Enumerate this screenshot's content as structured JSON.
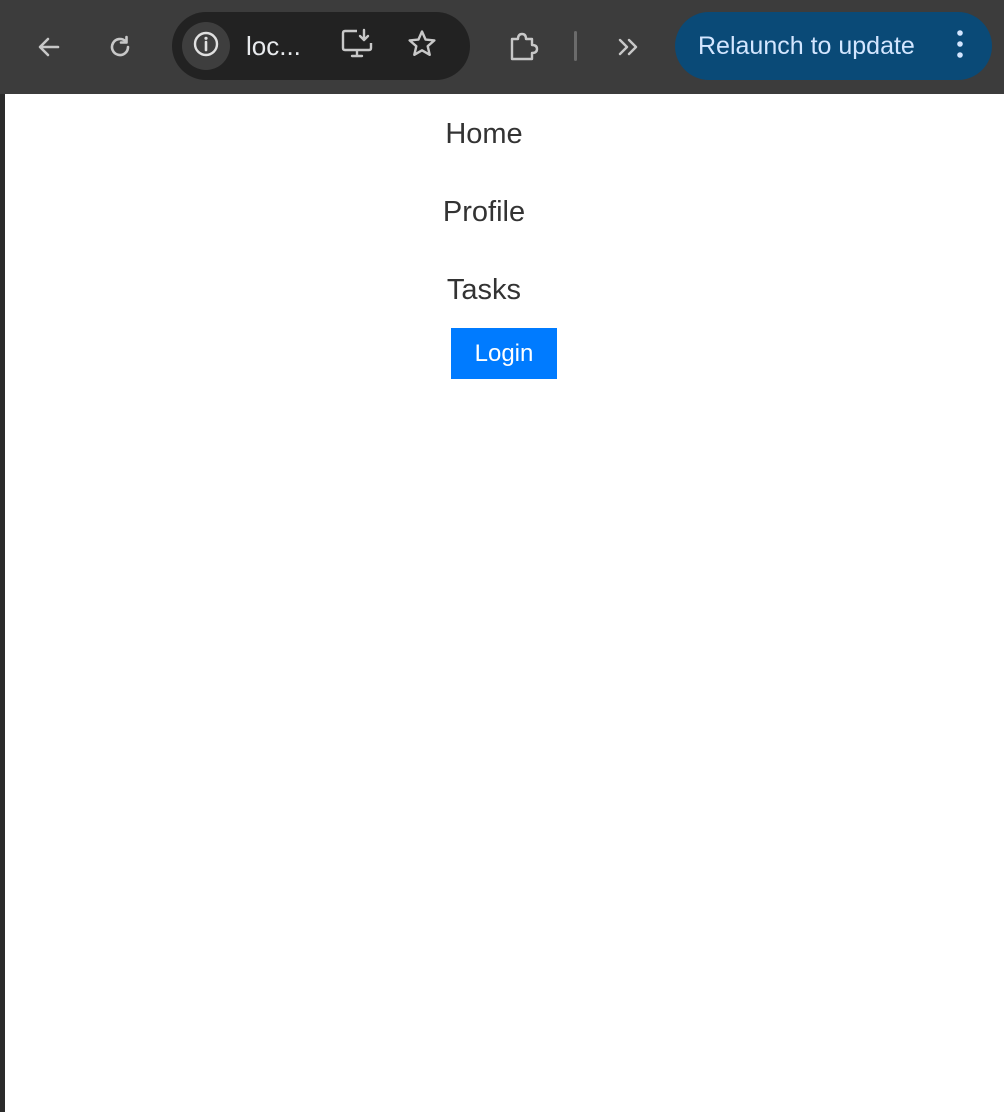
{
  "browser": {
    "url_display": "loc...",
    "relaunch_label": "Relaunch to update",
    "icons": {
      "back": "arrow-left-icon",
      "reload": "reload-icon",
      "site_info": "info-icon",
      "install": "install-app-icon",
      "bookmark": "star-icon",
      "extensions": "puzzle-icon",
      "overflow": "double-chevron-right-icon",
      "menu": "kebab-menu-icon"
    },
    "colors": {
      "toolbar": "#3c3c3c",
      "omnibox": "#222222",
      "relaunch_bg": "#0a4a77",
      "relaunch_text": "#d3e6ff"
    }
  },
  "nav": {
    "items": [
      {
        "label": "Home"
      },
      {
        "label": "Profile"
      },
      {
        "label": "Tasks"
      }
    ],
    "login_label": "Login"
  },
  "colors": {
    "login_button": "#007bff",
    "nav_text": "#333333"
  }
}
